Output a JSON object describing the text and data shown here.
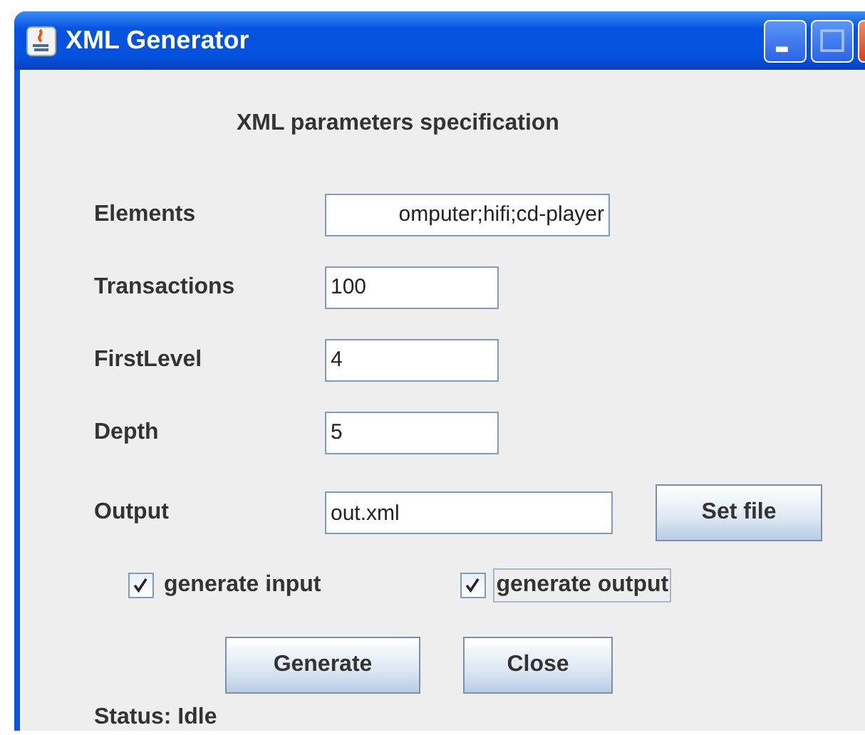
{
  "window": {
    "title": "XML Generator"
  },
  "heading": "XML parameters specification",
  "fields": [
    {
      "label": "Elements",
      "value": "omputer;hifi;cd-player",
      "kind": "wide"
    },
    {
      "label": "Transactions",
      "value": "100",
      "kind": "short"
    },
    {
      "label": "FirstLevel",
      "value": "4",
      "kind": "short"
    },
    {
      "label": "Depth",
      "value": "5",
      "kind": "short"
    },
    {
      "label": "Output",
      "value": "out.xml",
      "kind": "file",
      "button": "Set file"
    }
  ],
  "checkboxes": [
    {
      "label": "generate input",
      "checked": true,
      "focused": false
    },
    {
      "label": "generate output",
      "checked": true,
      "focused": true
    }
  ],
  "buttons": [
    "Generate",
    "Close"
  ],
  "status": "Status: Idle"
}
